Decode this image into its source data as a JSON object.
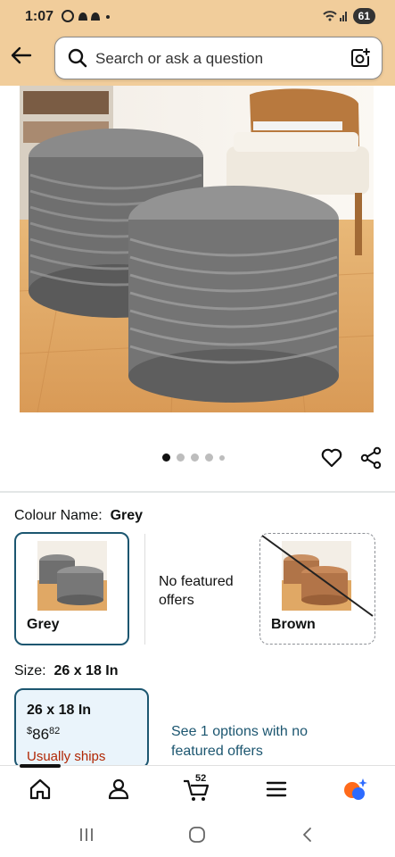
{
  "status": {
    "time": "1:07",
    "notifications": "◉ ◈ ◈ •",
    "battery": "61"
  },
  "search": {
    "placeholder": "Search or ask a question"
  },
  "product": {
    "image_count": 5,
    "active_image": 1
  },
  "colour": {
    "label": "Colour Name:",
    "selected": "Grey",
    "options": [
      {
        "name": "Grey",
        "available": true
      },
      {
        "name": "No featured offers"
      },
      {
        "name": "Brown",
        "available": false
      }
    ]
  },
  "size": {
    "label": "Size:",
    "selected": "26 x 18 In",
    "card": {
      "title": "26 x 18 In",
      "price_currency": "$",
      "price_whole": "86",
      "price_fraction": "82",
      "ships": "Usually ships"
    },
    "see_options": "See 1 options with no featured offers"
  },
  "nav": {
    "cart_count": "52"
  },
  "colors": {
    "header": "#f1cd9b",
    "accent": "#1c5670",
    "link": "#1c5670",
    "ships": "#b12704"
  }
}
